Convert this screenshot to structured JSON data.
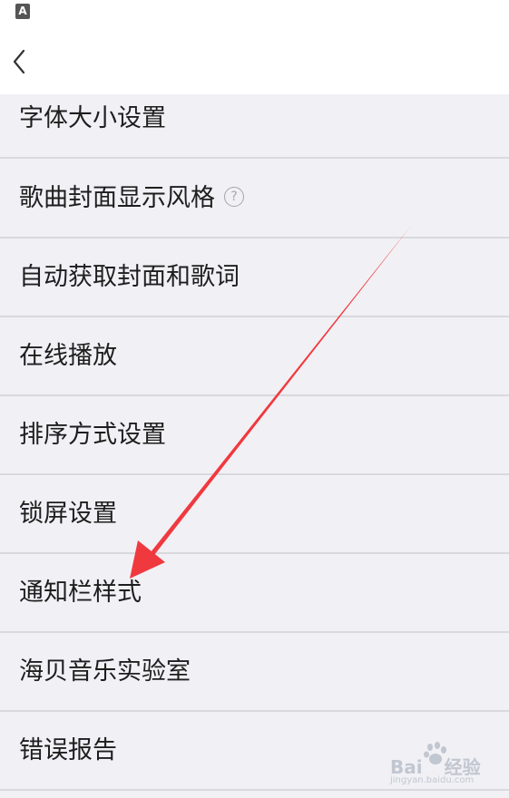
{
  "status_bar": {
    "icon": "keyboard-a-icon",
    "icon_text": "A"
  },
  "header": {
    "back_icon": "chevron-left-icon"
  },
  "settings": {
    "items": [
      {
        "label": "字体大小设置"
      },
      {
        "label": "歌曲封面显示风格",
        "has_help": true,
        "help_text": "?"
      },
      {
        "label": "自动获取封面和歌词"
      },
      {
        "label": "在线播放"
      },
      {
        "label": "排序方式设置"
      },
      {
        "label": "锁屏设置"
      },
      {
        "label": "通知栏样式"
      },
      {
        "label": "海贝音乐实验室"
      },
      {
        "label": "错误报告"
      }
    ]
  },
  "annotation": {
    "type": "red-arrow",
    "color": "#f0393f",
    "points_to": "通知栏样式"
  },
  "watermark": {
    "brand": "Bai",
    "brand_suffix": "经验",
    "url": "jingyan.baidu.com"
  },
  "colors": {
    "list_background": "#f1f0f4",
    "divider": "#d9d9dd",
    "text": "#1e1e1e",
    "header_background": "#ffffff"
  }
}
